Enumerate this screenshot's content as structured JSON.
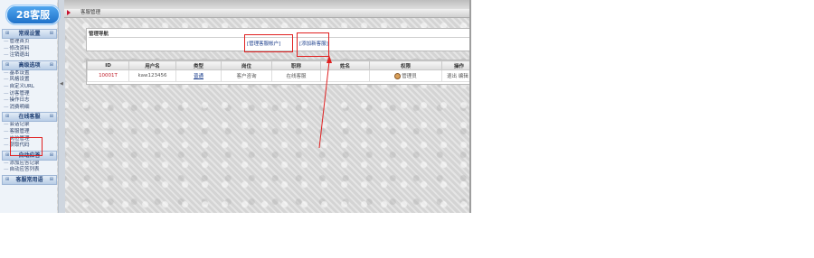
{
  "logo": {
    "text": "28客服"
  },
  "sidebar": {
    "sections": [
      {
        "title": "常规设置",
        "items": [
          "管理首页",
          "修改资料",
          "注销退出"
        ]
      },
      {
        "title": "高级选项",
        "items": [
          "基本设置",
          "风格设置",
          "自定义URL",
          "访客管理",
          "操作日志",
          "消费明细"
        ]
      },
      {
        "title": "在线客服",
        "items": [
          "会话记录",
          "客服管理",
          "岗位管理",
          "获取代码"
        ]
      },
      {
        "title": "自动应答",
        "items": [
          "添加应答记录",
          "自动应答列表"
        ]
      },
      {
        "title": "客服常用语",
        "items": []
      }
    ]
  },
  "topbar": {
    "title": "客服管理"
  },
  "nav": {
    "title": "管理导航",
    "links": [
      "[管理客服帐户]",
      "[添加新客服]"
    ]
  },
  "table": {
    "columns": [
      "ID",
      "用户名",
      "类型",
      "岗位",
      "职称",
      "姓名",
      "权限",
      "操作"
    ],
    "rows": [
      {
        "id": "10001T",
        "username": "kaw123456",
        "type": "普通",
        "post": "客户咨询",
        "title": "在线客服",
        "name": "",
        "perm": "管理员",
        "ops": "退出 编辑"
      }
    ]
  },
  "colors": {
    "logo": "#1d6fc8",
    "highlight": "#e02020",
    "link": "#1c3f8c"
  }
}
